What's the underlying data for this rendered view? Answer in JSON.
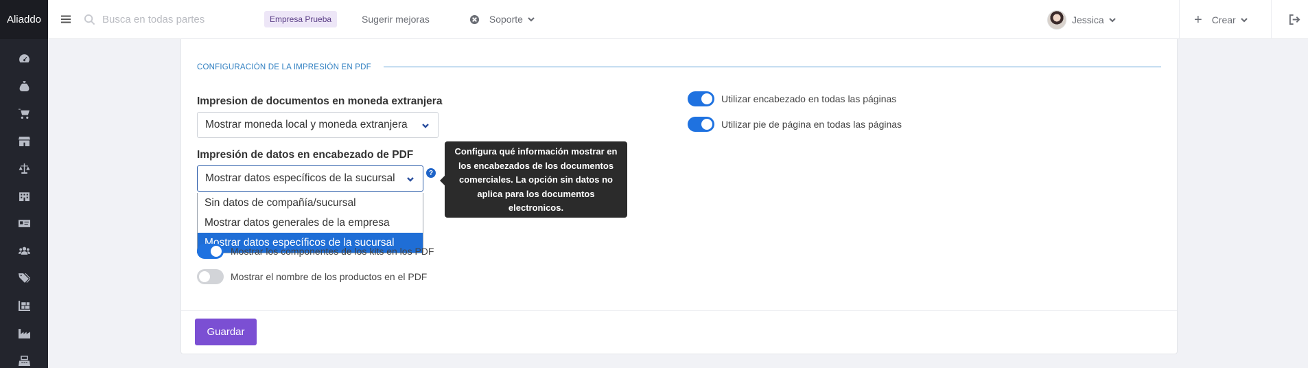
{
  "app": {
    "brand": "Aliaddo"
  },
  "sidebar": {
    "icons": [
      "dashboard-icon",
      "money-bag-icon",
      "cart-icon",
      "store-icon",
      "balance-scale-icon",
      "building-icon",
      "id-card-icon",
      "users-icon",
      "tags-icon",
      "warehouse-icon",
      "industry-icon",
      "cash-register-icon"
    ]
  },
  "topbar": {
    "search_placeholder": "Busca en todas partes",
    "company": "Empresa Prueba",
    "suggest": "Sugerir mejoras",
    "support": "Soporte",
    "user": "Jessica",
    "create": "Crear"
  },
  "pdf_section": {
    "title": "CONFIGURACIÓN DE LA IMPRESIÓN EN PDF",
    "foreign_currency": {
      "label": "Impresion de documentos en moneda extranjera",
      "value": "Mostrar moneda local y moneda extranjera"
    },
    "header_data": {
      "label": "Impresión de datos en encabezado de PDF",
      "value": "Mostrar datos específicos de la sucursal",
      "options": [
        "Sin datos de compañía/sucursal",
        "Mostrar datos generales de la empresa",
        "Mostrar datos específicos de la sucursal"
      ],
      "selected_index": 2,
      "help_icon": "?",
      "tooltip": "Configura qué información mostrar en los encabezados de los documentos comerciales. La opción sin datos no aplica para los documentos electronicos."
    },
    "toggles_left": [
      {
        "label": "Mostrar los componentes de los kits en los PDF",
        "on": true
      },
      {
        "label": "Mostrar el nombre de los productos en el PDF",
        "on": false
      }
    ],
    "toggles_right": [
      {
        "label": "Utilizar encabezado en todas las páginas",
        "on": true
      },
      {
        "label": "Utilizar pie de página en todas las páginas",
        "on": true
      }
    ]
  },
  "actions": {
    "save": "Guardar"
  },
  "colors": {
    "accent": "#7b4fd3",
    "toggle_on": "#1f72e0",
    "section_title": "#2f7fc1"
  }
}
